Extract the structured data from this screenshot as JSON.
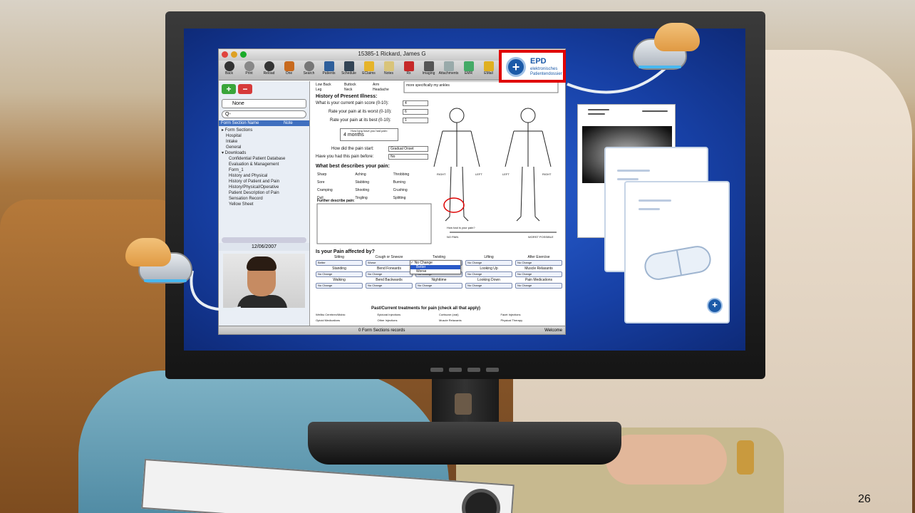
{
  "window": {
    "title": "15385-1   Rickard, James G",
    "toolbar": [
      "Back",
      "Print",
      "Reload",
      "One",
      "Search",
      "Patients",
      "Schedule",
      "EClaims",
      "Notes",
      "Rx",
      "Imaging",
      "Attachments",
      "EMR",
      "EMail"
    ]
  },
  "sidebar": {
    "add_label": "+",
    "remove_label": "−",
    "filter": "None",
    "search_placeholder": "Q-",
    "col_name": "Form Section Name",
    "col_note": "Note",
    "tree": [
      "▸ Form Sections",
      "Hospital",
      "Intake",
      "General",
      "▾ Downloads",
      "Confidential Patient Database",
      "Evaluation & Management",
      "Form_1",
      "History and Physical",
      "History of Patient and Pain",
      "History/Physical/Operative",
      "Patient Description of Pain",
      "Sensation Record",
      "Yellow Sheet"
    ],
    "date": "12/06/2007"
  },
  "form": {
    "top_checks": [
      "Low Back",
      "Buttock",
      "Arm",
      "Leg",
      "Neck",
      "Headache"
    ],
    "top_note": "more specifically my ankles",
    "hpi_title": "History of Present Illness:",
    "q_current": "What is your current pain score (0-10):",
    "v_current": "4",
    "q_worst": "Rate your pain at its worst (0-10):",
    "v_worst": "6",
    "q_best": "Rate your pain at its best (0-10):",
    "v_best": "1",
    "q_howlong": "How long have you had pain:",
    "v_howlong": "4 months",
    "q_start": "How did the pain start:",
    "v_start": "Gradual Onset",
    "q_before": "Have you had this pain before:",
    "v_before": "No",
    "desc_title": "What best describes your pain:",
    "desc": [
      "Sharp",
      "Aching",
      "Throbbing",
      "Sore",
      "Stabbing",
      "Burning",
      "Cramping",
      "Shooting",
      "Crushing",
      "Dull",
      "Tingling",
      "Splitting"
    ],
    "further": "Further describe pain:",
    "body_labels": [
      "RIGHT",
      "LEFT",
      "LEFT",
      "RIGHT"
    ],
    "scale_q": "How bad is your pain?",
    "scale_l": "NO PAIN",
    "scale_r": "WORST POSSIBLE",
    "affected_title": "Is your Pain affected by?",
    "affected": [
      {
        "label": "Sitting",
        "value": "Better"
      },
      {
        "label": "Cough or Sneeze",
        "value": "Worse"
      },
      {
        "label": "Twisting",
        "value": "No Change"
      },
      {
        "label": "Lifting",
        "value": "No Change"
      },
      {
        "label": "After Exercise",
        "value": "No Change"
      },
      {
        "label": "Standing",
        "value": "No Change"
      },
      {
        "label": "Bend Forwards",
        "value": "No Change"
      },
      {
        "label": "",
        "value": "No Change"
      },
      {
        "label": "Looking Up",
        "value": "No Change"
      },
      {
        "label": "Muscle Relaxants",
        "value": "No Change"
      },
      {
        "label": "Walking",
        "value": "No Change"
      },
      {
        "label": "Bend Backwards",
        "value": "No Change"
      },
      {
        "label": "Nighttime",
        "value": "No Change"
      },
      {
        "label": "Looking Down",
        "value": "No Change"
      },
      {
        "label": "Pain Medications",
        "value": "No Change"
      }
    ],
    "dropdown": [
      "✓ No Change",
      "Better",
      "Worse"
    ],
    "treat_title": "Past/Current treatments for pain (check all that apply)",
    "treat": [
      "Wellbu Cerebrex/Mobic",
      "Epidural Injections",
      "Cortisone (oral)",
      "Facet Injections",
      "Opioid Medications",
      "Other Injections",
      "Muscle Relaxants",
      "Physical Therapy"
    ]
  },
  "statusbar": {
    "center": "0 Form Sections records",
    "right": "Welcome"
  },
  "epd": {
    "title": "EPD",
    "sub1": "elektronisches",
    "sub2": "Patientendossier"
  },
  "page_number": "26",
  "colors": {
    "accent": "#1b5aa8",
    "highlight": "#e00000",
    "screen": "#1740a5"
  }
}
